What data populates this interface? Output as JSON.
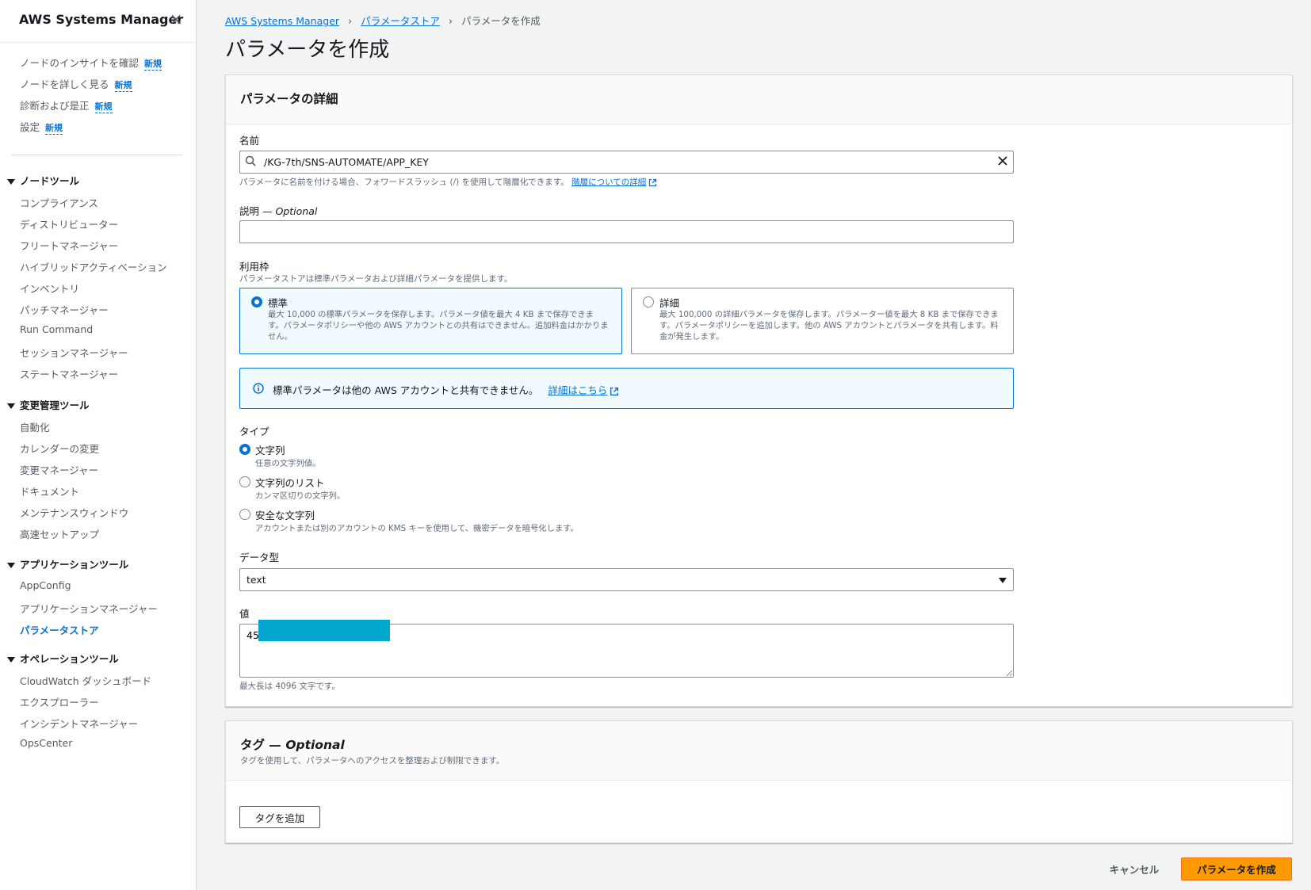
{
  "sidebar": {
    "brand": "AWS Systems Manager",
    "close_symbol": "×",
    "top_items": [
      {
        "label": "ノードのインサイトを確認",
        "badge": "新規"
      },
      {
        "label": "ノードを詳しく見る",
        "badge": "新規"
      },
      {
        "label": "診断および是正",
        "badge": "新規"
      },
      {
        "label": "設定",
        "badge": "新規"
      }
    ],
    "sections": [
      {
        "title": "ノードツール",
        "items": [
          "コンプライアンス",
          "ディストリビューター",
          "フリートマネージャー",
          "ハイブリッドアクティベーション",
          "インベントリ",
          "パッチマネージャー",
          "Run Command",
          "セッションマネージャー",
          "ステートマネージャー"
        ]
      },
      {
        "title": "変更管理ツール",
        "items": [
          "自動化",
          "カレンダーの変更",
          "変更マネージャー",
          "ドキュメント",
          "メンテナンスウィンドウ",
          "高速セットアップ"
        ]
      },
      {
        "title": "アプリケーションツール",
        "items": [
          "AppConfig",
          "アプリケーションマネージャー",
          "パラメータストア"
        ]
      },
      {
        "title": "オペレーションツール",
        "items": [
          "CloudWatch ダッシュボード",
          "エクスプローラー",
          "インシデントマネージャー",
          "OpsCenter"
        ]
      }
    ],
    "active_item": "パラメータストア"
  },
  "breadcrumb": {
    "items": [
      "AWS Systems Manager",
      "パラメータストア"
    ],
    "current": "パラメータを作成"
  },
  "page_title": "パラメータを作成",
  "details": {
    "title": "パラメータの詳細",
    "name_label": "名前",
    "name_value": "/KG-7th/SNS-AUTOMATE/APP_KEY",
    "name_hint": "パラメータに名前を付ける場合、フォワードスラッシュ (/) を使用して階層化できます。",
    "name_hint_link": "階層についての詳細",
    "description_label": "説明",
    "description_optional": "— Optional",
    "description_value": "",
    "tier_label": "利用枠",
    "tier_hint": "パラメータストアは標準パラメータおよび詳細パラメータを提供します。",
    "tiers": [
      {
        "title": "標準",
        "desc": "最大 10,000 の標準パラメータを保存します。パラメータ値を最大 4 KB まで保存できます。パラメータポリシーや他の AWS アカウントとの共有はできません。追加料金はかかりません。",
        "selected": true
      },
      {
        "title": "詳細",
        "desc": "最大 100,000 の詳細パラメータを保存します。パラメーター値を最大 8 KB まで保存できます。パラメータポリシーを追加します。他の AWS アカウントとパラメータを共有します。料金が発生します。",
        "selected": false
      }
    ],
    "info_text": "標準パラメータは他の AWS アカウントと共有できません。",
    "info_link": "詳細はこちら",
    "type_label": "タイプ",
    "types": [
      {
        "label": "文字列",
        "desc": "任意の文字列値。",
        "selected": true
      },
      {
        "label": "文字列のリスト",
        "desc": "カンマ区切りの文字列。",
        "selected": false
      },
      {
        "label": "安全な文字列",
        "desc": "アカウントまたは別のアカウントの KMS キーを使用して、機密データを暗号化します。",
        "selected": false
      }
    ],
    "datatype_label": "データ型",
    "datatype_value": "text",
    "value_label": "値",
    "value_visible": "45",
    "value_hint": "最大長は 4096 文字です。"
  },
  "tags": {
    "title": "タグ",
    "title_optional": "— Optional",
    "desc": "タグを使用して、パラメータへのアクセスを整理および制限できます。",
    "add_button": "タグを追加"
  },
  "footer": {
    "cancel_label": "キャンセル",
    "create_label": "パラメータを作成"
  },
  "colors": {
    "accent": "#0972d3",
    "primary_button": "#ff9900",
    "redaction": "#01a7ce"
  }
}
